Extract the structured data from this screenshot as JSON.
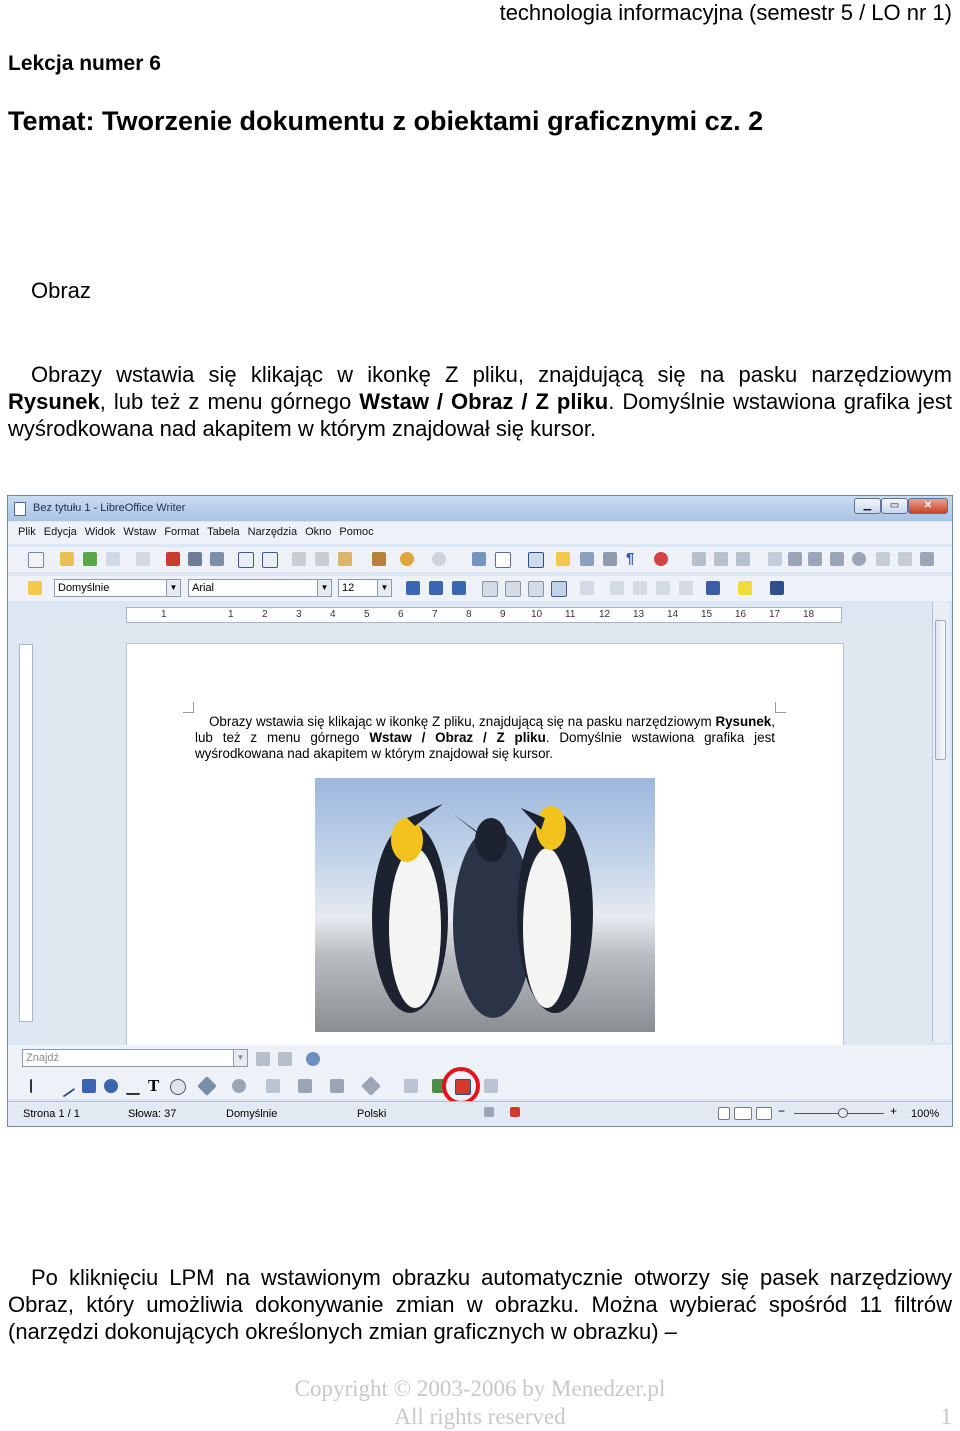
{
  "header": {
    "course": "technologia informacyjna (semestr 5 / LO nr 1)"
  },
  "lesson": "Lekcja numer 6",
  "topic": "Temat: Tworzenie dokumentu z obiektami graficznymi cz. 2",
  "section_title": "Obraz",
  "para1": {
    "t1": "Obrazy wstawia się klikając w ikonkę Z pliku, znajdującą się na pasku narzędziowym ",
    "b1": "Rysunek",
    "t2": ", lub też z menu górnego ",
    "b2": "Wstaw / Obraz / Z pliku",
    "t3": ". Domyślnie wstawiona grafika jest wyśrodkowana nad akapitem w którym znajdował się kursor."
  },
  "screenshot": {
    "title": "Bez tytułu 1 - LibreOffice Writer",
    "window_buttons": [
      "▁",
      "▭",
      "✕"
    ],
    "menu": [
      "Plik",
      "Edycja",
      "Widok",
      "Wstaw",
      "Format",
      "Tabela",
      "Narzędzia",
      "Okno",
      "Pomoc"
    ],
    "style_box": "Domyślnie",
    "font_box": "Arial",
    "size_box": "12",
    "ruler_numbers": [
      "1",
      "1",
      "2",
      "3",
      "4",
      "5",
      "6",
      "7",
      "8",
      "9",
      "10",
      "11",
      "12",
      "13",
      "14",
      "15",
      "16",
      "17",
      "18"
    ],
    "find_placeholder": "Znajdź",
    "status": {
      "page": "Strona 1 / 1",
      "words": "Słowa: 37",
      "style": "Domyślnie",
      "language": "Polski",
      "zoom": "100%"
    },
    "icon_colors": {
      "accent": "#e0141b",
      "toolbar_bg": "#eef2f8",
      "title_bg": "#a9c4e4"
    }
  },
  "para2": "Po kliknięciu LPM na wstawionym obrazku automatycznie otworzy się pasek narzędziowy Obraz, który umożliwia dokonywanie zmian w obrazku. Można wybierać spośród 11 filtrów (narzędzi dokonujących określonych zmian graficznych w obrazku) –",
  "footer": {
    "copyright": "Copyright © 2003-2006 by Menedzer.pl",
    "rights": "All rights reserved",
    "page_number": "1"
  }
}
